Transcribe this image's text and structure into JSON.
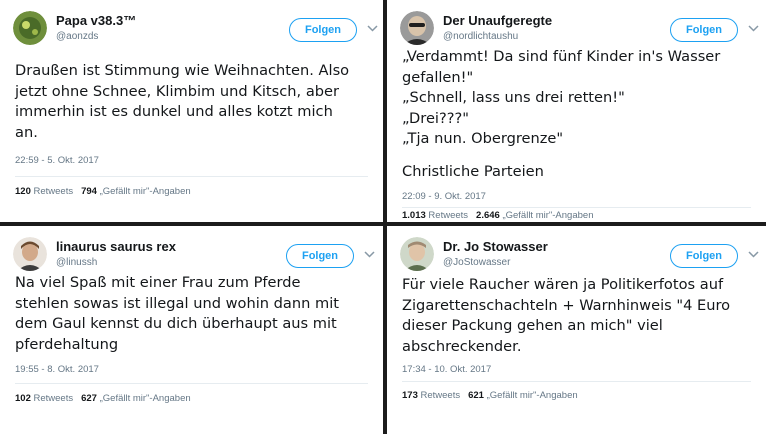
{
  "tweets": [
    {
      "display_name": "Papa v38.3™",
      "handle": "@aonzds",
      "follow_label": "Folgen",
      "lines": [
        "Draußen ist Stimmung wie Weihnachten. Also",
        "jetzt ohne Schnee, Klimbim und Kitsch, aber",
        "immerhin ist es dunkel und alles kotzt mich",
        "an."
      ],
      "timestamp": "22:59 - 5. Okt. 2017",
      "retweets": "120",
      "retweets_label": "Retweets",
      "likes": "794",
      "likes_label": "„Gefällt mir\"-Angaben"
    },
    {
      "display_name": "Der Unaufgeregte",
      "handle": "@nordlichtaushu",
      "follow_label": "Folgen",
      "lines": [
        "„Verdammt! Da sind fünf Kinder in's Wasser",
        "gefallen!\"",
        "„Schnell, lass uns drei retten!\"",
        "„Drei???\"",
        "„Tja nun. Obergrenze\""
      ],
      "tag_line": "Christliche Parteien",
      "timestamp": "22:09 - 9. Okt. 2017",
      "retweets": "1.013",
      "retweets_label": "Retweets",
      "likes": "2.646",
      "likes_label": "„Gefällt mir\"-Angaben"
    },
    {
      "display_name": "linaurus saurus rex",
      "handle": "@linussh",
      "follow_label": "Folgen",
      "lines": [
        "Na viel Spaß mit einer Frau zum Pferde",
        "stehlen sowas ist illegal und wohin dann mit",
        "dem Gaul kennst du dich überhaupt aus mit",
        "pferdehaltung"
      ],
      "timestamp": "19:55 - 8. Okt. 2017",
      "retweets": "102",
      "retweets_label": "Retweets",
      "likes": "627",
      "likes_label": "„Gefällt mir\"-Angaben"
    },
    {
      "display_name": "Dr. Jo Stowasser",
      "handle": "@JoStowasser",
      "follow_label": "Folgen",
      "lines": [
        "Für viele Raucher wären ja Politikerfotos auf",
        "Zigarettenschachteln + Warnhinweis \"4 Euro",
        "dieser Packung gehen an mich\" viel",
        "abschreckender."
      ],
      "timestamp": "17:34 - 10. Okt. 2017",
      "retweets": "173",
      "retweets_label": "Retweets",
      "likes": "621",
      "likes_label": "„Gefällt mir\"-Angaben"
    }
  ],
  "icons": {
    "more": "chevron-down-icon"
  },
  "colors": {
    "accent": "#1da1f2",
    "text": "#14171a",
    "secondary_text": "#657786",
    "divider": "#1c1c1c"
  }
}
